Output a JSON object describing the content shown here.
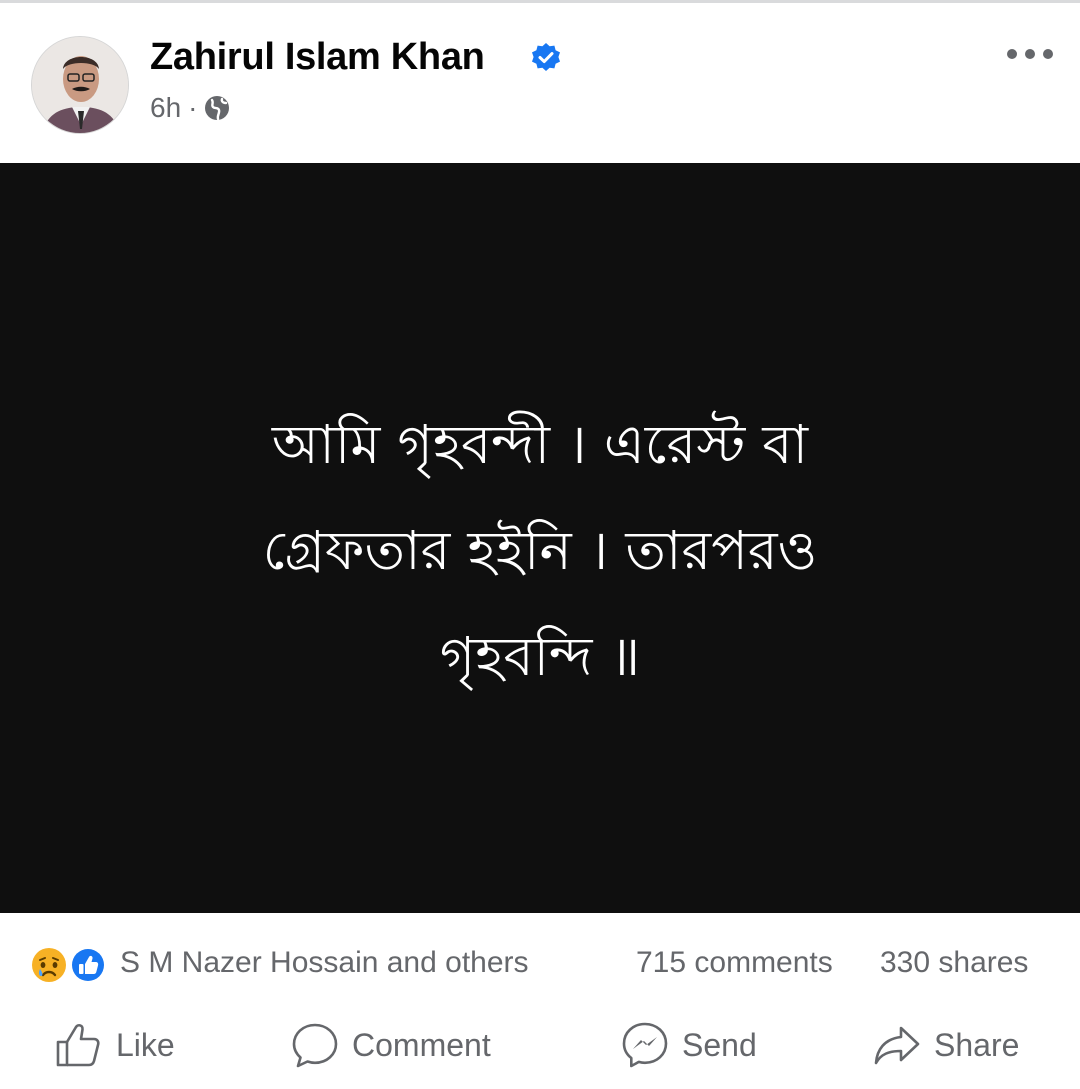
{
  "post": {
    "author": "Zahirul Islam Khan",
    "verified": true,
    "time": "6h",
    "separator": "·",
    "privacy_icon": "globe-icon",
    "menu_icon": "more-options-icon",
    "image_text_lines": [
      "আমি গৃহবন্দী । এরেস্ট বা",
      "গ্রেফতার হইনি । তারপরও",
      "গৃহবন্দি ॥"
    ]
  },
  "stats": {
    "reactions_text": "S M Nazer Hossain and others",
    "reaction_icons": [
      "sad-reaction-icon",
      "like-reaction-icon"
    ],
    "comments": "715 comments",
    "shares": "330 shares"
  },
  "actions": {
    "like": "Like",
    "comment": "Comment",
    "send": "Send",
    "share": "Share"
  },
  "colors": {
    "verified_blue": "#1877f2",
    "secondary_text": "#65676b",
    "image_background": "#0f0f0f",
    "like_blue": "#1877f2",
    "sad_yellow": "#f7b125"
  }
}
